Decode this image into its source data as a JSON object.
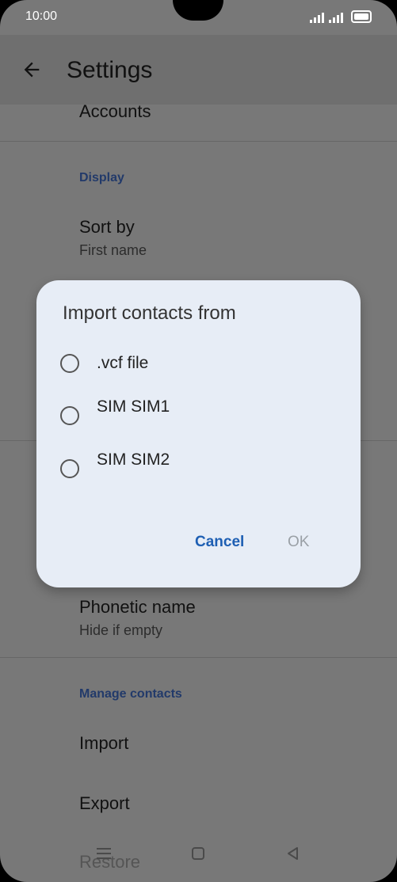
{
  "status": {
    "time": "10:00"
  },
  "appbar": {
    "title": "Settings"
  },
  "list": {
    "accounts": "Accounts",
    "display_header": "Display",
    "sort_by": {
      "title": "Sort by",
      "value": "First name"
    },
    "phonetic": {
      "title": "Phonetic name",
      "value": "Hide if empty"
    },
    "manage_header": "Manage contacts",
    "import": "Import",
    "export": "Export",
    "restore": "Restore"
  },
  "dialog": {
    "title": "Import contacts from",
    "options": [
      ".vcf file",
      "SIM SIM1",
      "SIM SIM2"
    ],
    "cancel": "Cancel",
    "ok": "OK"
  },
  "icons": {
    "back": "arrow-back-icon",
    "menu": "menu-icon",
    "home": "home-square-icon",
    "nav_back": "triangle-back-icon"
  }
}
